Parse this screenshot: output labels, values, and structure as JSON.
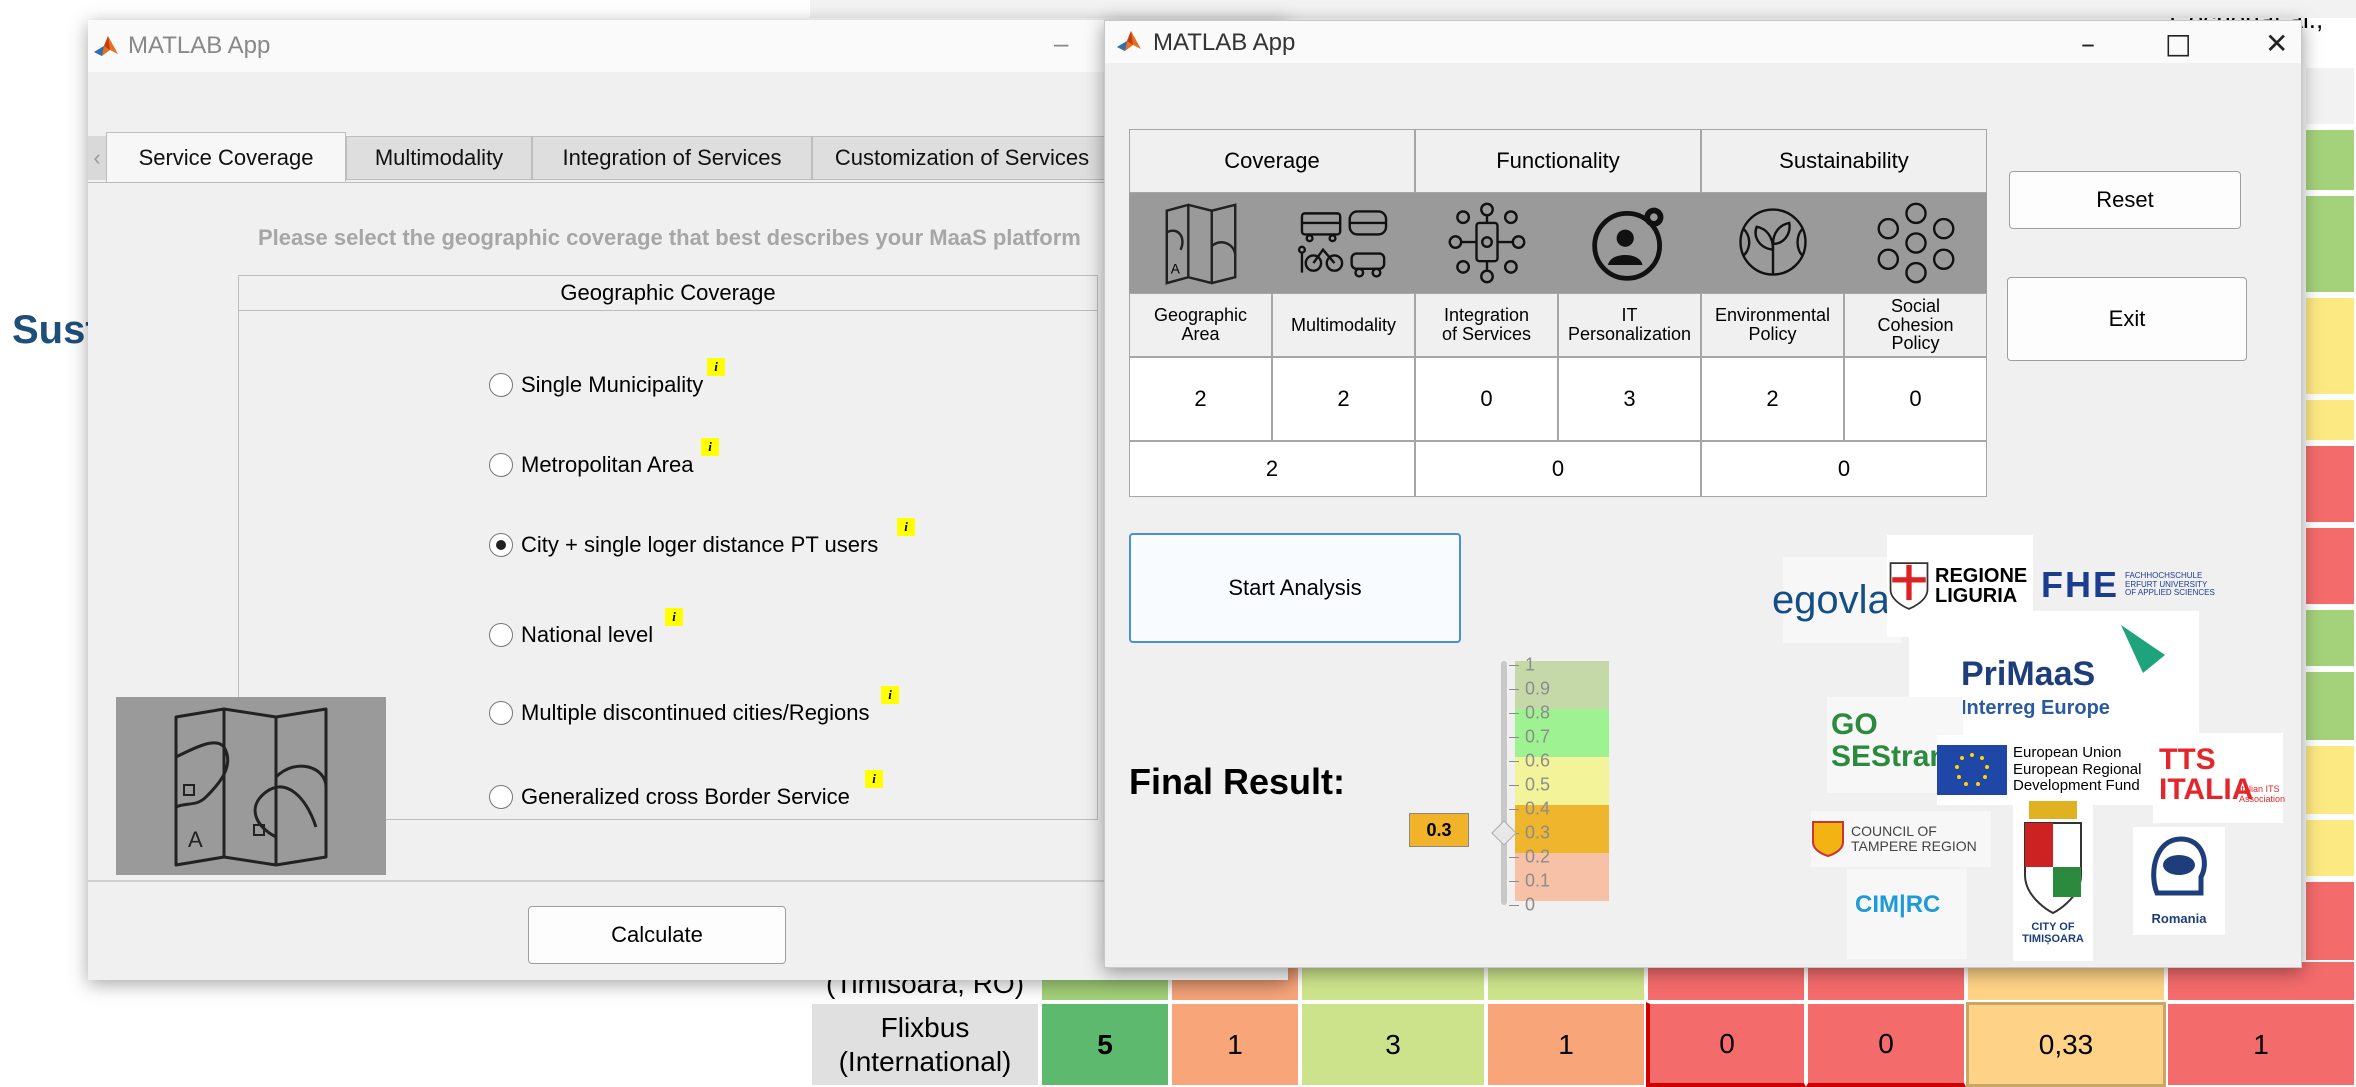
{
  "background": {
    "sust_fragment": "Sust",
    "author_fragment": "Cochonat al.,",
    "row_city_fragment": "(Timisoara, RO)",
    "row_flixbus": {
      "name": "Flixbus\n(International)",
      "cells": [
        "5",
        "1",
        "3",
        "1",
        "0",
        "0",
        "0,33",
        "1"
      ]
    }
  },
  "colors": {
    "green_dark": "#5cb96e",
    "orange": "#f8a57a",
    "lime": "#cde38b",
    "red": "#f46b6b",
    "peach": "#ffd387",
    "side_green": "#a4d27a",
    "side_yellow": "#fde982",
    "side_red": "#f46b6b"
  },
  "window1": {
    "title": "MATLAB App",
    "tabs": [
      "Service Coverage",
      "Multimodality",
      "Integration of Services",
      "Customization of Services"
    ],
    "active_tab": "Service Coverage",
    "prompt": "Please select the geographic coverage that best describes your MaaS platform",
    "group_title": "Geographic Coverage",
    "options": [
      {
        "label": "Single Municipality",
        "selected": false
      },
      {
        "label": "Metropolitan Area",
        "selected": false
      },
      {
        "label": "City + single loger distance PT users",
        "selected": true
      },
      {
        "label": "National level",
        "selected": false
      },
      {
        "label": "Multiple discontinued cities/Regions",
        "selected": false
      },
      {
        "label": "Generalized cross Border Service",
        "selected": false
      }
    ],
    "info_glyph": "i",
    "map_icon": "folded-map-icon",
    "calculate_label": "Calculate"
  },
  "window2": {
    "title": "MATLAB App",
    "controls": {
      "minimize": "–",
      "maximize": "□",
      "close": "✕"
    },
    "table": {
      "groups": [
        "Coverage",
        "Functionality",
        "Sustainability"
      ],
      "criteria": [
        "Geographic\nArea",
        "Multimodality",
        "Integration\nof Services",
        "IT\nPersonalization",
        "Environmental\nPolicy",
        "Social\nCohesion\nPolicy"
      ],
      "criteria_icons": [
        "map-icon",
        "transport-modes-icon",
        "network-phone-icon",
        "user-gear-icon",
        "globe-plant-icon",
        "community-icon"
      ],
      "scores": [
        "2",
        "2",
        "0",
        "3",
        "2",
        "0"
      ],
      "group_scores": [
        "2",
        "0",
        "0"
      ]
    },
    "reset_label": "Reset",
    "exit_label": "Exit",
    "start_label": "Start Analysis",
    "final_label": "Final Result:",
    "gauge": {
      "value": 0.3,
      "value_text": "0.3",
      "ticks": [
        "1",
        "0.9",
        "0.8",
        "0.7",
        "0.6",
        "0.5",
        "0.4",
        "0.3",
        "0.2",
        "0.1",
        "0"
      ]
    },
    "logos": {
      "egovlab": "egovlab",
      "regione": "REGIONE\nLIGURIA",
      "fhe": "FHE",
      "fhe_sub": "FACHHOCHSCHULE\nERFURT UNIVERSITY\nOF APPLIED SCIENCES",
      "primaas": "PriMaaS",
      "interreg": "Interreg Europe",
      "gosestran": "GO\nSEStran",
      "eu": "European Union\nEuropean Regional\nDevelopment Fund",
      "tts": "TTS\nITALIA",
      "tts_sub": "Italian ITS\nAssociation",
      "tampere": "COUNCIL OF\nTAMPERE REGION",
      "cimrc": "CIM|RC",
      "timisoara": "CITY OF\nTIMIȘOARA",
      "its_romania": "Romania"
    }
  }
}
